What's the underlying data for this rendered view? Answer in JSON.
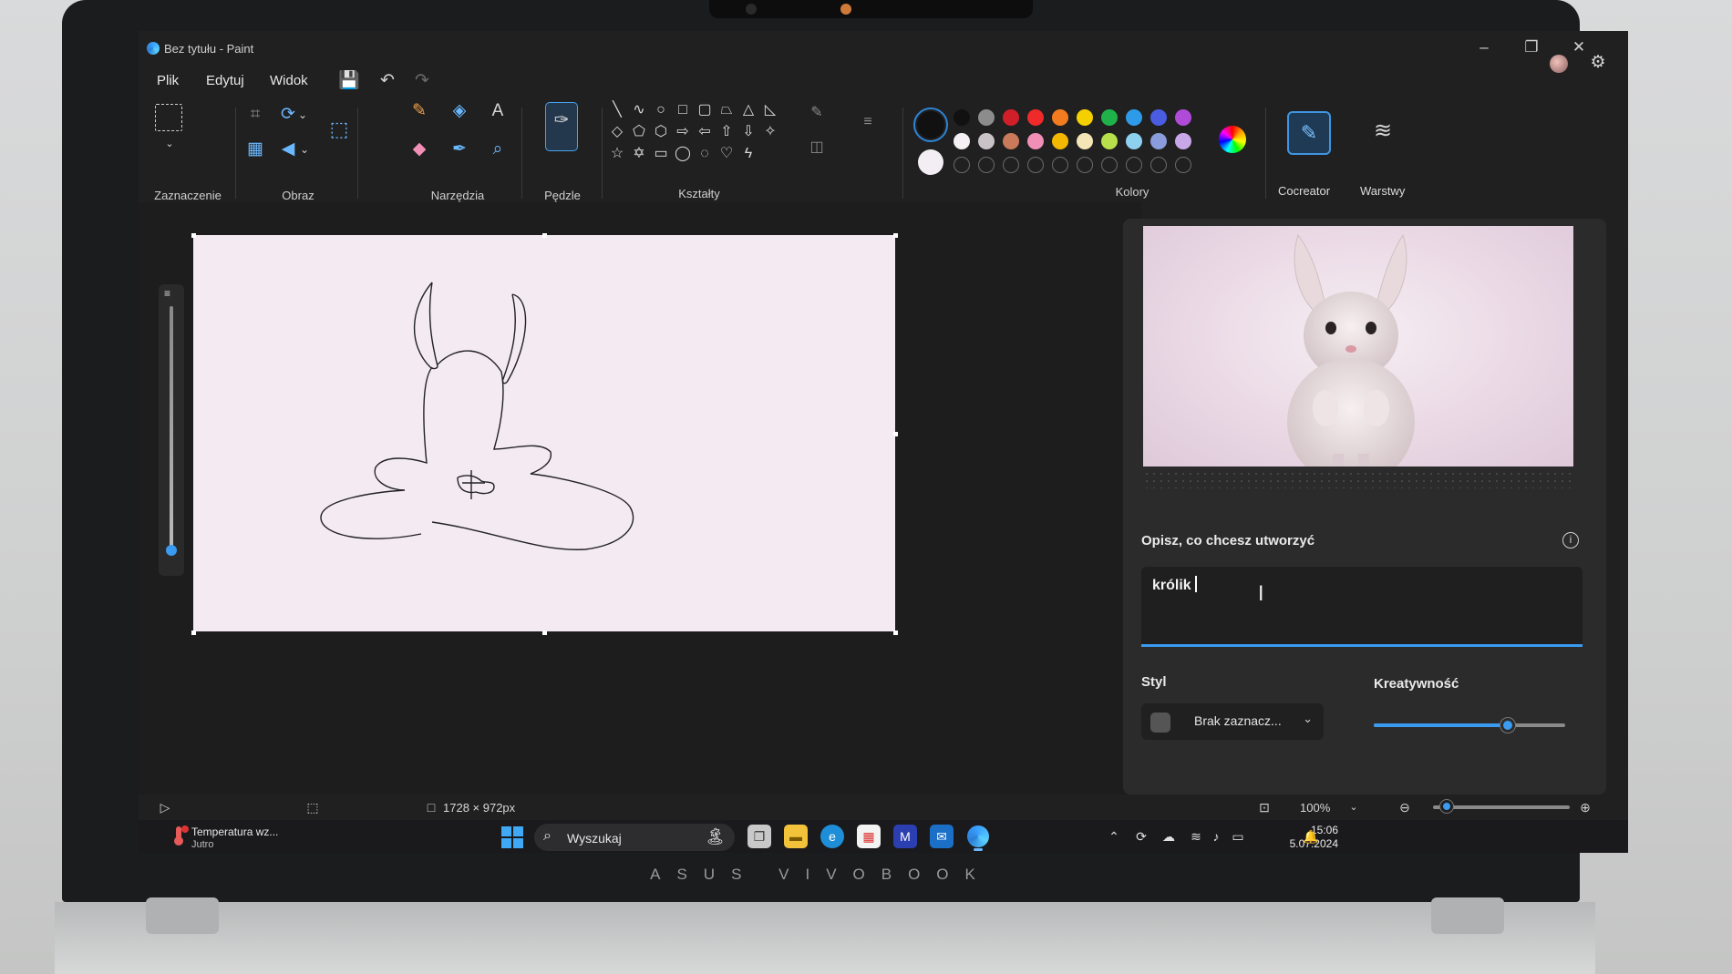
{
  "window": {
    "title": "Bez tytułu - Paint"
  },
  "menu": {
    "file": "Plik",
    "edit": "Edytuj",
    "view": "Widok"
  },
  "ribbon": {
    "selection_label": "Zaznaczenie",
    "image_label": "Obraz",
    "tools_label": "Narzędzia",
    "brushes_label": "Pędzle",
    "shapes_label": "Kształty",
    "colors_label": "Kolory",
    "cocreator_label": "Cocreator",
    "layers_label": "Warstwy"
  },
  "palette": {
    "primary": "#111111",
    "secondary": "#f2eef3",
    "row1": [
      "#111111",
      "#8c8c8c",
      "#d11f2a",
      "#ee2a2a",
      "#f47c20",
      "#f5d000",
      "#1fb14a",
      "#2e9be8",
      "#4a5ce0",
      "#b04ad8"
    ],
    "row2": [
      "#f5f0f4",
      "#c9c3c8",
      "#c97a5a",
      "#f28fb6",
      "#f5b800",
      "#f5e6b8",
      "#b8e04a",
      "#8ed0ef",
      "#8a9cdc",
      "#c8a8e8"
    ]
  },
  "cocreator": {
    "prompt_label": "Opisz, co chcesz utworzyć",
    "prompt_value": "królik",
    "style_label": "Styl",
    "style_value": "Brak zaznacz...",
    "creativity_label": "Kreatywność",
    "creativity_level": 0.7
  },
  "statusbar": {
    "canvas_size": "1728 × 972px",
    "zoom": "100%"
  },
  "taskbar": {
    "weather_title": "Temperatura wz...",
    "weather_sub": "Jutro",
    "search_placeholder": "Wyszukaj",
    "time": "15:06",
    "date": "5.07.2024"
  },
  "device": {
    "brand": "ASUS VIVOBOOK"
  }
}
